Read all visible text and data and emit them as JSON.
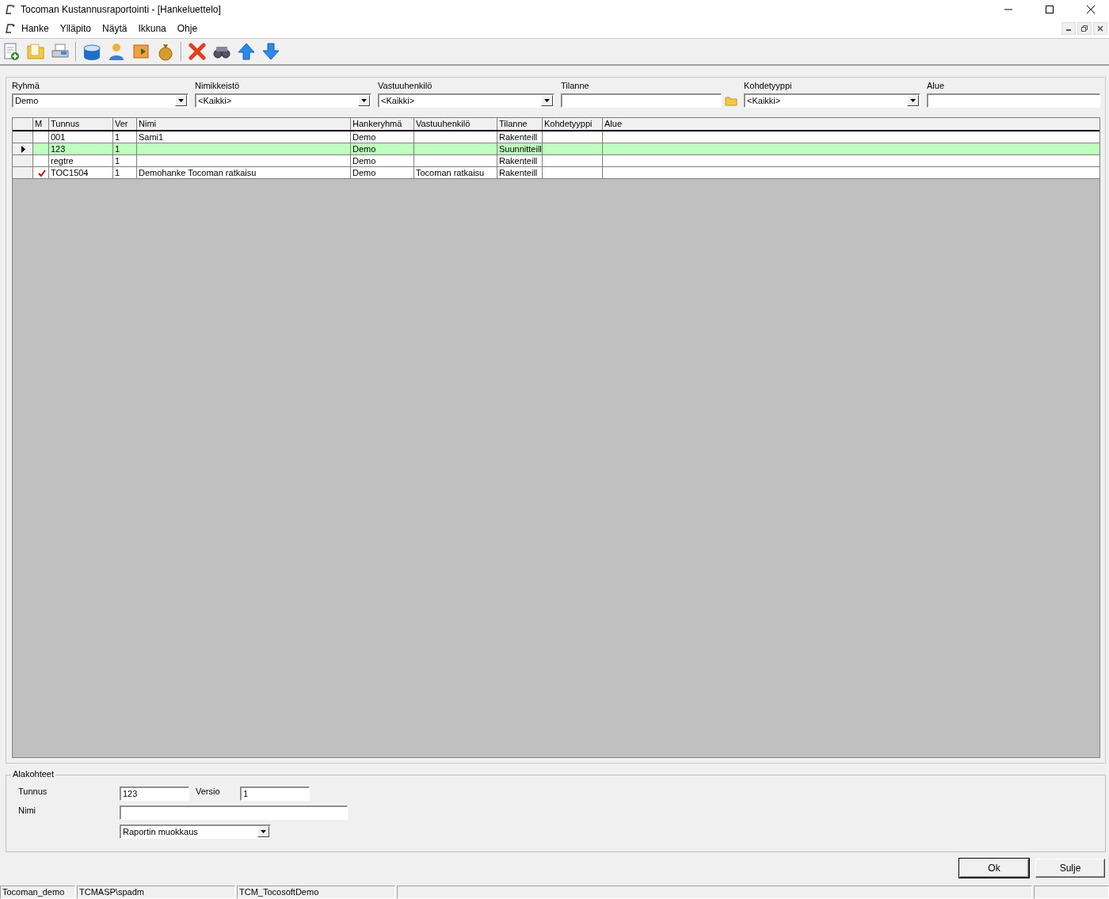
{
  "window": {
    "title": "Tocoman Kustannusraportointi - [Hankeluettelo]"
  },
  "menu": [
    "Hanke",
    "Ylläpito",
    "Näytä",
    "Ikkuna",
    "Ohje"
  ],
  "filters": [
    {
      "label": "Ryhmä",
      "value": "Demo",
      "kind": "combo"
    },
    {
      "label": "Nimikkeistö",
      "value": "<Kaikki>",
      "kind": "combo"
    },
    {
      "label": "Vastuuhenkilö",
      "value": "<Kaikki>",
      "kind": "combo"
    },
    {
      "label": "Tilanne",
      "kind": "folder"
    },
    {
      "label": "Kohdetyyppi",
      "value": "<Kaikki>",
      "kind": "combo"
    },
    {
      "label": "Alue",
      "kind": "text"
    }
  ],
  "table": {
    "columns": [
      "M",
      "Tunnus",
      "Ver",
      "Nimi",
      "Hankeryhmä",
      "Vastuuhenkilö",
      "Tilanne",
      "Kohdetyyppi",
      "Alue"
    ],
    "rows": [
      {
        "selected": false,
        "marked": false,
        "cells": [
          "",
          "001",
          "1",
          "Sami1",
          "Demo",
          "",
          "Rakenteill",
          "",
          ""
        ]
      },
      {
        "selected": true,
        "marked": false,
        "cells": [
          "",
          "123",
          "1",
          "",
          "Demo",
          "",
          "Suunnitteill",
          "",
          ""
        ]
      },
      {
        "selected": false,
        "marked": false,
        "cells": [
          "",
          "regtre",
          "1",
          "",
          "Demo",
          "",
          "Rakenteill",
          "",
          ""
        ]
      },
      {
        "selected": false,
        "marked": true,
        "cells": [
          "",
          "TOC1504",
          "1",
          "Demohanke Tocoman ratkaisu",
          "Demo",
          "Tocoman ratkaisu",
          "Rakenteill",
          "",
          ""
        ]
      }
    ]
  },
  "details": {
    "title": "Alakohteet",
    "tunnus_label": "Tunnus",
    "tunnus": "123",
    "versio_label": "Versio",
    "versio": "1",
    "nimi_label": "Nimi",
    "report": "Raportin muokkaus"
  },
  "buttons": [
    "Ok",
    "Sulje"
  ],
  "status_bar": [
    "Tocoman_demo",
    "TCMASP\\spadm",
    "TCM_TocosoftDemo"
  ]
}
